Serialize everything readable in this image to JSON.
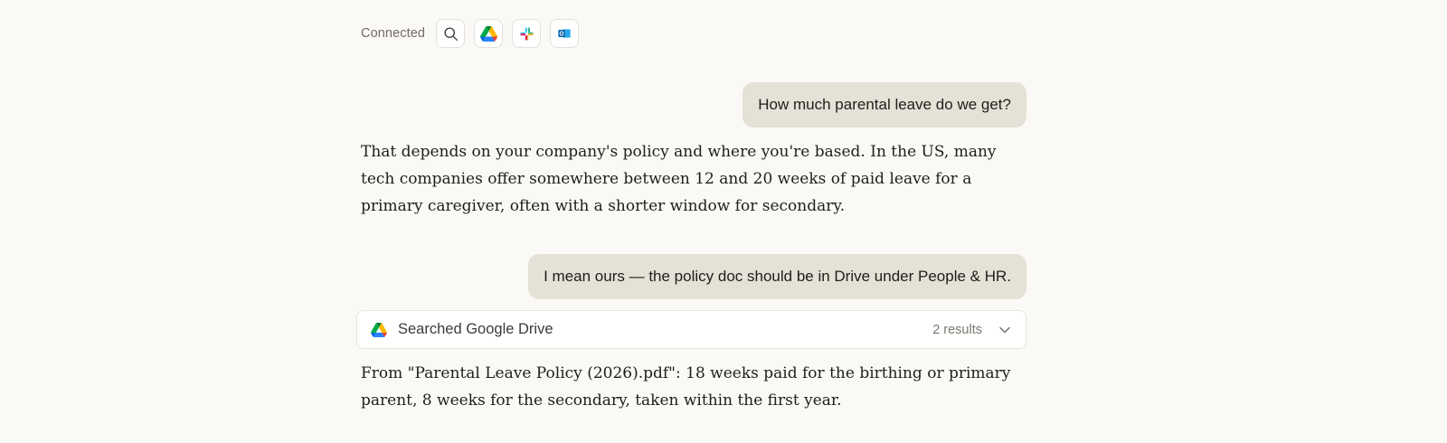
{
  "connectors": {
    "label": "Connected",
    "items": [
      {
        "name": "search-icon"
      },
      {
        "name": "google-drive-icon"
      },
      {
        "name": "slack-icon"
      },
      {
        "name": "outlook-icon"
      }
    ]
  },
  "conversation": {
    "user_1": "How much parental leave do we get?",
    "assistant_1": "That depends on your company's policy and where you're based. In the US, many tech companies offer somewhere between 12 and 20 weeks of paid leave for a primary caregiver, often with a shorter window for secondary.",
    "user_2": "I mean ours — the policy doc should be in Drive under People & HR.",
    "tool_call": {
      "icon": "google-drive-icon",
      "title": "Searched Google Drive",
      "results": "2 results",
      "expand_icon": "chevron-down-icon"
    },
    "assistant_2": "From \"Parental Leave Policy (2026).pdf\": 18 weeks paid for the birthing or primary parent, 8 weeks for the secondary, taken within the first year."
  },
  "colors": {
    "background": "#faf9f5",
    "user_bubble": "#e4e1d6",
    "text": "#1f1e1b",
    "muted": "#6f6c64"
  }
}
